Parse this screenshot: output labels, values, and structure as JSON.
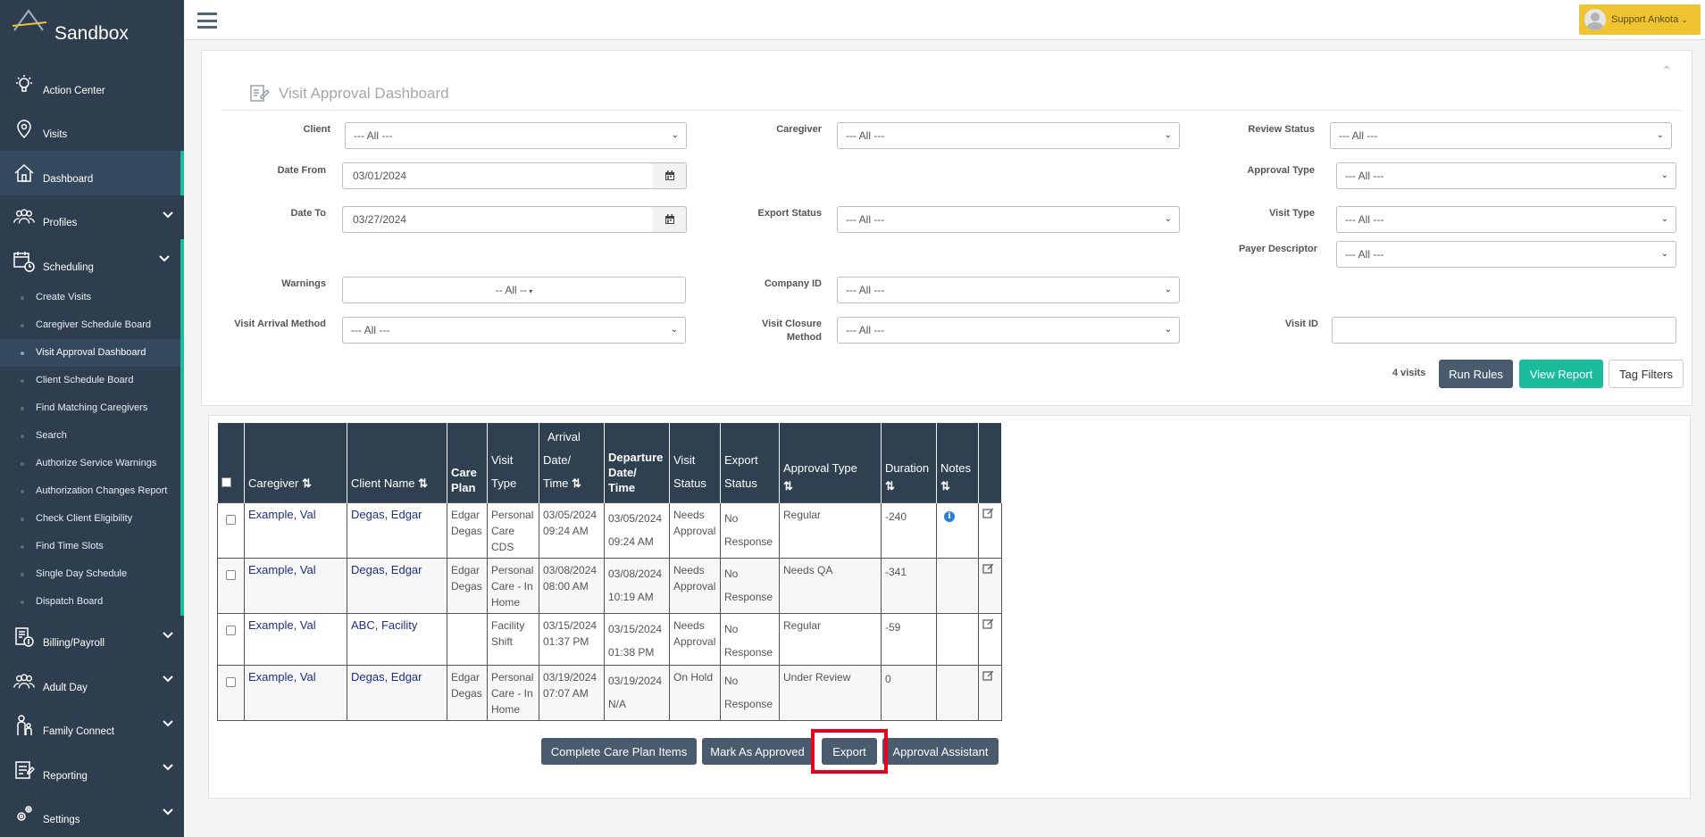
{
  "sidebar": {
    "brand": "Sandbox",
    "items": [
      {
        "label": "Action Center"
      },
      {
        "label": "Visits"
      },
      {
        "label": "Dashboard"
      },
      {
        "label": "Profiles"
      },
      {
        "label": "Scheduling"
      }
    ],
    "scheduling_sub": [
      {
        "label": "Create Visits"
      },
      {
        "label": "Caregiver Schedule Board"
      },
      {
        "label": "Visit Approval Dashboard"
      },
      {
        "label": "Client Schedule Board"
      },
      {
        "label": "Find Matching Caregivers"
      },
      {
        "label": "Search"
      },
      {
        "label": "Authorize Service Warnings"
      },
      {
        "label": "Authorization Changes Report"
      },
      {
        "label": "Check Client Eligibility"
      },
      {
        "label": "Find Time Slots"
      },
      {
        "label": "Single Day Schedule"
      },
      {
        "label": "Dispatch Board"
      }
    ],
    "items_bottom": [
      {
        "label": "Billing/Payroll"
      },
      {
        "label": "Adult Day"
      },
      {
        "label": "Family Connect"
      },
      {
        "label": "Reporting"
      },
      {
        "label": "Settings"
      }
    ]
  },
  "topbar": {
    "user_label": "Support Ankota"
  },
  "filters": {
    "title": "Visit Approval Dashboard",
    "client_label": "Client",
    "client_value": "--- All ---",
    "caregiver_label": "Caregiver",
    "caregiver_value": "--- All ---",
    "review_status_label": "Review Status",
    "review_status_value": "--- All ---",
    "date_from_label": "Date From",
    "date_from_value": "03/01/2024",
    "approval_type_label": "Approval Type",
    "approval_type_value": "--- All ---",
    "date_to_label": "Date To",
    "date_to_value": "03/27/2024",
    "export_status_label": "Export Status",
    "export_status_value": "--- All ---",
    "visit_type_label": "Visit Type",
    "visit_type_value": "--- All ---",
    "payer_descriptor_label": "Payer Descriptor",
    "payer_descriptor_value": "--- All ---",
    "warnings_label": "Warnings",
    "warnings_value": "-- All --",
    "company_id_label": "Company ID",
    "company_id_value": "--- All ---",
    "visit_arrival_label": "Visit Arrival Method",
    "visit_arrival_value": "--- All ---",
    "visit_closure_label_1": "Visit Closure",
    "visit_closure_label_2": "Method",
    "visit_closure_value": "--- All ---",
    "visit_id_label": "Visit ID",
    "visits_count": "4 visits",
    "run_rules": "Run Rules",
    "view_report": "View Report",
    "tag_filters": "Tag Filters"
  },
  "table": {
    "headers": {
      "caregiver": "Caregiver",
      "client_name": "Client Name",
      "care_plan_1": "Care",
      "care_plan_2": "Plan",
      "visit_type_1": "Visit",
      "visit_type_2": "Type",
      "arrival_1": "Arrival",
      "arrival_2": "Date/",
      "arrival_3": "Time",
      "departure_1": "Departure",
      "departure_2": "Date/",
      "departure_3": "Time",
      "visit_status_1": "Visit",
      "visit_status_2": "Status",
      "export_status_1": "Export",
      "export_status_2": "Status",
      "approval_type": "Approval Type",
      "duration": "Duration",
      "notes": "Notes"
    },
    "rows": [
      {
        "caregiver": "Example, Val",
        "client": "Degas, Edgar",
        "care_plan_1": "Edgar",
        "care_plan_2": "Degas",
        "visit_type_1": "Personal",
        "visit_type_2": "Care",
        "visit_type_3": "CDS",
        "arrival_1": "03/05/2024",
        "arrival_2": "09:24 AM",
        "departure_1": "03/05/2024",
        "departure_2": "09:24 AM",
        "status_1": "Needs",
        "status_2": "Approval",
        "export_1": "No",
        "export_2": "Response",
        "approval": "Regular",
        "duration": "-240",
        "has_note": true
      },
      {
        "caregiver": "Example, Val",
        "client": "Degas, Edgar",
        "care_plan_1": "Edgar",
        "care_plan_2": "Degas",
        "visit_type_1": "Personal",
        "visit_type_2": "Care - In",
        "visit_type_3": "Home",
        "arrival_1": "03/08/2024",
        "arrival_2": "08:00 AM",
        "departure_1": "03/08/2024",
        "departure_2": "10:19 AM",
        "status_1": "Needs",
        "status_2": "Approval",
        "export_1": "No",
        "export_2": "Response",
        "approval": "Needs QA",
        "duration": "-341",
        "has_note": false
      },
      {
        "caregiver": "Example, Val",
        "client": "ABC, Facility",
        "care_plan_1": "",
        "care_plan_2": "",
        "visit_type_1": "Facility",
        "visit_type_2": "Shift",
        "visit_type_3": "",
        "arrival_1": "03/15/2024",
        "arrival_2": "01:37 PM",
        "departure_1": "03/15/2024",
        "departure_2": "01:38 PM",
        "status_1": "Needs",
        "status_2": "Approval",
        "export_1": "No",
        "export_2": "Response",
        "approval": "Regular",
        "duration": "-59",
        "has_note": false
      },
      {
        "caregiver": "Example, Val",
        "client": "Degas, Edgar",
        "care_plan_1": "Edgar",
        "care_plan_2": "Degas",
        "visit_type_1": "Personal",
        "visit_type_2": "Care - In",
        "visit_type_3": "Home",
        "arrival_1": "03/19/2024",
        "arrival_2": "07:07 AM",
        "departure_1": "03/19/2024",
        "departure_2": "N/A",
        "status_1": "On Hold",
        "status_2": "",
        "export_1": "No",
        "export_2": "Response",
        "approval": "Under Review",
        "duration": "0",
        "has_note": false
      }
    ]
  },
  "actions": {
    "complete_care_plan": "Complete Care Plan Items",
    "mark_approved": "Mark As Approved",
    "export": "Export",
    "approval_assistant": "Approval Assistant"
  }
}
